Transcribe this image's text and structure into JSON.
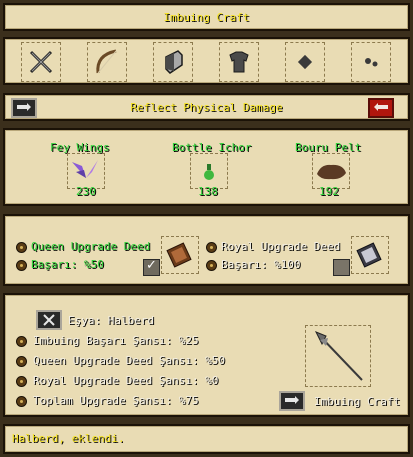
{
  "window": {
    "title": "Imbuing Craft"
  },
  "category_tabs": [
    {
      "icon": "crossed-swords-icon"
    },
    {
      "icon": "bow-icon"
    },
    {
      "icon": "shield-icon"
    },
    {
      "icon": "armor-icon"
    },
    {
      "icon": "gem-icon"
    },
    {
      "icon": "pellets-icon"
    }
  ],
  "property": {
    "name": "Reflect Physical Damage"
  },
  "ingredients": [
    {
      "name": "Fey Wings",
      "count": "230",
      "icon": "fey-wings-icon"
    },
    {
      "name": "Bottle Ichor",
      "count": "138",
      "icon": "ichor-bottle-icon"
    },
    {
      "name": "Bouru Pelt",
      "count": "192",
      "icon": "pelt-icon"
    }
  ],
  "deeds": {
    "queen": {
      "label": "Queen Upgrade Deed",
      "success": "Başarı: %50",
      "checked": true
    },
    "royal": {
      "label": "Royal Upgrade Deed",
      "success": "Başarı: %100",
      "checked": false
    }
  },
  "item": {
    "label": "Eşya: Halberd",
    "stats": [
      "Imbuing Başarı Şansı: %25",
      "Queen Upgrade Deed Şansı: %50",
      "Royal Upgrade Deed Şansı: %0",
      "Toplam Upgrade Şansı: %75"
    ],
    "craft_label": "Imbuing Craft"
  },
  "status": {
    "message": "Halberd, eklendi."
  },
  "colors": {
    "parchment": "#e9dcb4",
    "label_yellow": "#f5e21f",
    "label_green": "#31d23a",
    "button_red": "#b1160d"
  }
}
